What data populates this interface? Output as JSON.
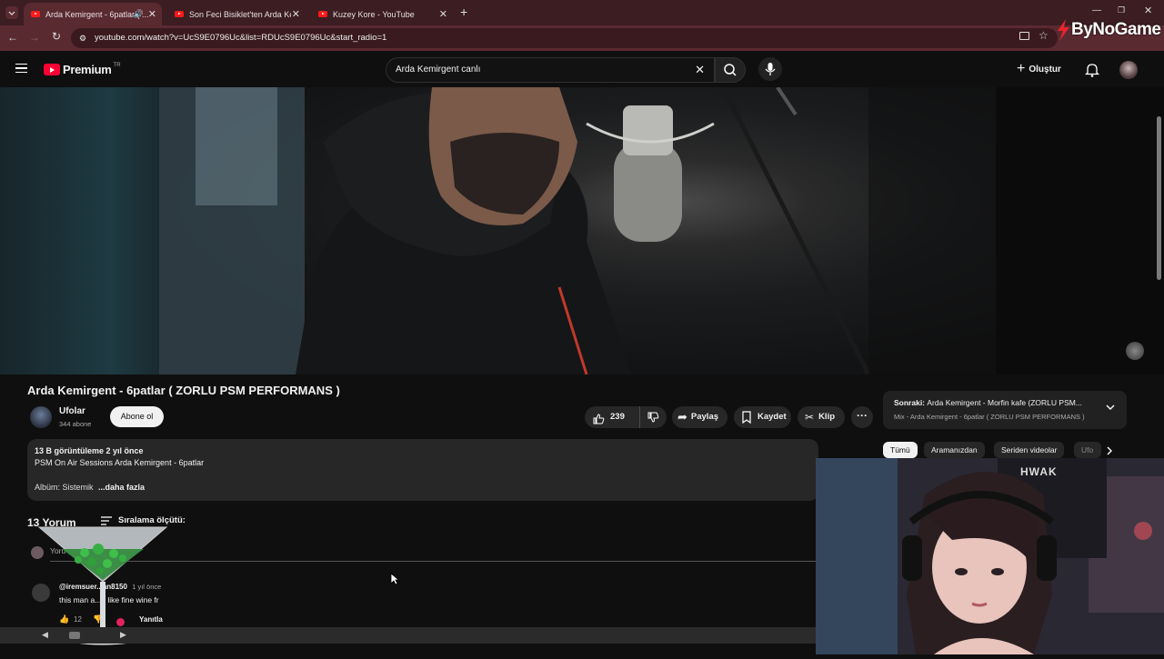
{
  "browser": {
    "tabs": [
      {
        "title": "Arda Kemirgent - 6patlar ( ..."
      },
      {
        "title": "Son Feci Bisiklet'ten Arda Kemi..."
      },
      {
        "title": "Kuzey Kore - YouTube"
      }
    ],
    "url": "youtube.com/watch?v=UcS9E0796Uc&list=RDUcS9E0796Uc&start_radio=1",
    "overlay_logo": "ByNoGame"
  },
  "masthead": {
    "logo_text": "Premium",
    "logo_badge": "TR",
    "search_value": "Arda Kemirgent canlı",
    "create_label": "Oluştur"
  },
  "video": {
    "title": "Arda Kemirgent - 6patlar ( ZORLU PSM PERFORMANS )"
  },
  "channel": {
    "name": "Ufolar",
    "subs": "344 abone",
    "subscribe_label": "Abone ol"
  },
  "actions": {
    "likes": "239",
    "share": "Paylaş",
    "save": "Kaydet",
    "clip": "Klip"
  },
  "description": {
    "stats": "13 B görüntüleme  2 yıl önce",
    "line1": "PSM On Air Sessions Arda Kemirgent - 6patlar",
    "line2_prefix": "Albüm: Sistemik",
    "more": "...daha fazla"
  },
  "next_up": {
    "label": "Sonraki:",
    "title": "Arda Kemirgent - Morfin kafe (ZORLU PSM...",
    "sub": "Mix - Arda Kemirgent - 6patlar ( ZORLU PSM PERFORMANS )"
  },
  "chips": [
    "Tümü",
    "Aramanızdan",
    "Seriden videolar",
    "Ufo"
  ],
  "comments": {
    "count_label": "13 Yorum",
    "sort_label": "Sıralama ölçütü:",
    "add_placeholder": "Yoru",
    "items": [
      {
        "author": "@iremsuer...an8150",
        "time": "1 yıl önce",
        "text": "this man a...d like fine wine fr",
        "likes": "12",
        "reply": "Yanıtla"
      }
    ]
  },
  "webcam": {
    "poster_text": "HWAK"
  }
}
